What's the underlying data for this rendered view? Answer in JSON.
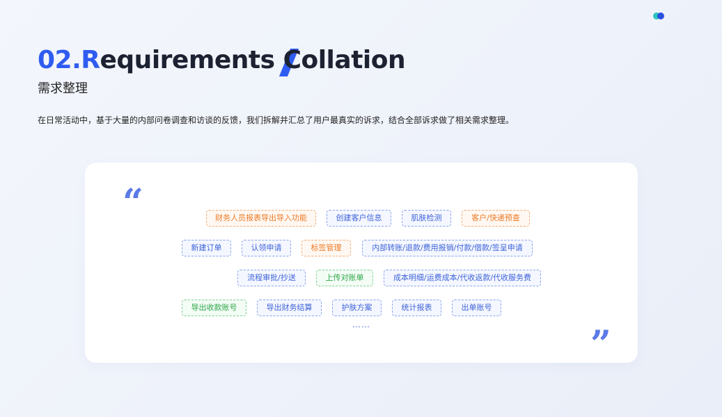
{
  "header": {
    "title_accent": "02.R",
    "title_middle": "equirements ",
    "title_slash_letter": "C",
    "title_rest": "ollation",
    "subtitle": "需求整理",
    "description": "在日常活动中，基于大量的内部问卷调查和访谈的反馈，我们拆解并汇总了用户最真实的诉求，结合全部诉求做了相关需求整理。"
  },
  "card": {
    "quote_open": "“",
    "quote_close": "”",
    "tags": [
      {
        "label": "财务人员报表导出导入功能",
        "color": "orange"
      },
      {
        "label": "创建客户信息",
        "color": "blue"
      },
      {
        "label": "肌肤检测",
        "color": "blue"
      },
      {
        "label": "客户/快递预查",
        "color": "orange"
      },
      {
        "label": "新建订单",
        "color": "blue"
      },
      {
        "label": "认领申请",
        "color": "blue"
      },
      {
        "label": "标签管理",
        "color": "orange"
      },
      {
        "label": "内部转账/退款/费用报销/付款/借款/签呈申请",
        "color": "blue"
      },
      {
        "label": "流程审批/抄送",
        "color": "blue"
      },
      {
        "label": "上传对账单",
        "color": "green"
      },
      {
        "label": "成本明细/运费成本/代收返款/代收服务费",
        "color": "blue"
      },
      {
        "label": "导出收款账号",
        "color": "green"
      },
      {
        "label": "导出财务结算",
        "color": "blue"
      },
      {
        "label": "护肤方案",
        "color": "blue"
      },
      {
        "label": "统计报表",
        "color": "blue"
      },
      {
        "label": "出单账号",
        "color": "blue"
      }
    ],
    "ellipsis": "……"
  },
  "colors": {
    "accent_blue": "#2f5cf0",
    "tag_blue": "#3e63d8",
    "tag_orange": "#ec7a26",
    "tag_green": "#2ea84a"
  }
}
